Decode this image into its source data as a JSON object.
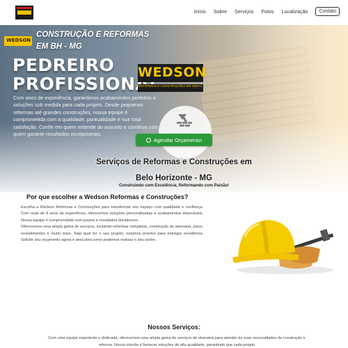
{
  "nav": {
    "links": [
      "Início",
      "Sobre",
      "Serviços",
      "Fotos",
      "Localização"
    ],
    "contact_label": "Contato"
  },
  "hero": {
    "logo_text": "WEDSON",
    "headline": "CONSTRUÇÃO E REFORMAS EM BH - MG",
    "title_line1": "PEDREIRO",
    "title_line2": "PROFISSIONAL",
    "paragraph": "Com anos de experiência, garantimos acabamentos perfeitos e soluções sob medida para cada projeto. Desde pequenas reformas até grandes construções, nossa equipe é comprometida com a qualidade, pontualidade e sua total satisfação. Confie em quem entende do assunto e construa com quem garante resultados excepcionais.",
    "brand_name": "WEDSON",
    "brand_sub": "REFORMAS E CONSTRUÇÕES EM GERAL",
    "cta_label": "Agendar Orçamento!",
    "section_title_line1": "Serviços de Reformas e Construções em",
    "section_title_line2": "Belo Horizonte - MG",
    "section_subtitle": "Construindo com Excelência, Reformando com Paixão!"
  },
  "why": {
    "title": "Por que escolher a Wedson Reformas e Construções?",
    "paragraph1": "Escolha a Wedson Reformas e Construções para transformar seu espaço com qualidade e confiança. Com mais de 8 anos de experiência, oferecemos soluções personalizadas e acabamentos impecáveis. Nossa equipe é comprometida com prazos e resultados duradouros.",
    "paragraph2": "Oferecemos uma ampla gama de serviços, incluindo reformas completas, construção de alvenaria, pisos, revestimentos e muito mais. Seja qual for o seu projeto, estamos prontos para entregar excelência. Solicite seu orçamento agora e descubra como podemos realizar o seu sonho."
  },
  "services": {
    "title": "Nossos Serviços:",
    "paragraph": "Com uma equipe experiente e dedicada, oferecemos uma ampla gama de serviços de alvenaria para atender às suas necessidades de construção e reforma. Nossa missão é fornecer soluções de alta qualidade, garantindo que cada projeto"
  },
  "colors": {
    "accent_yellow": "#f3c300",
    "cta_green": "#2b9a3a",
    "dark": "#1c1c1c"
  }
}
